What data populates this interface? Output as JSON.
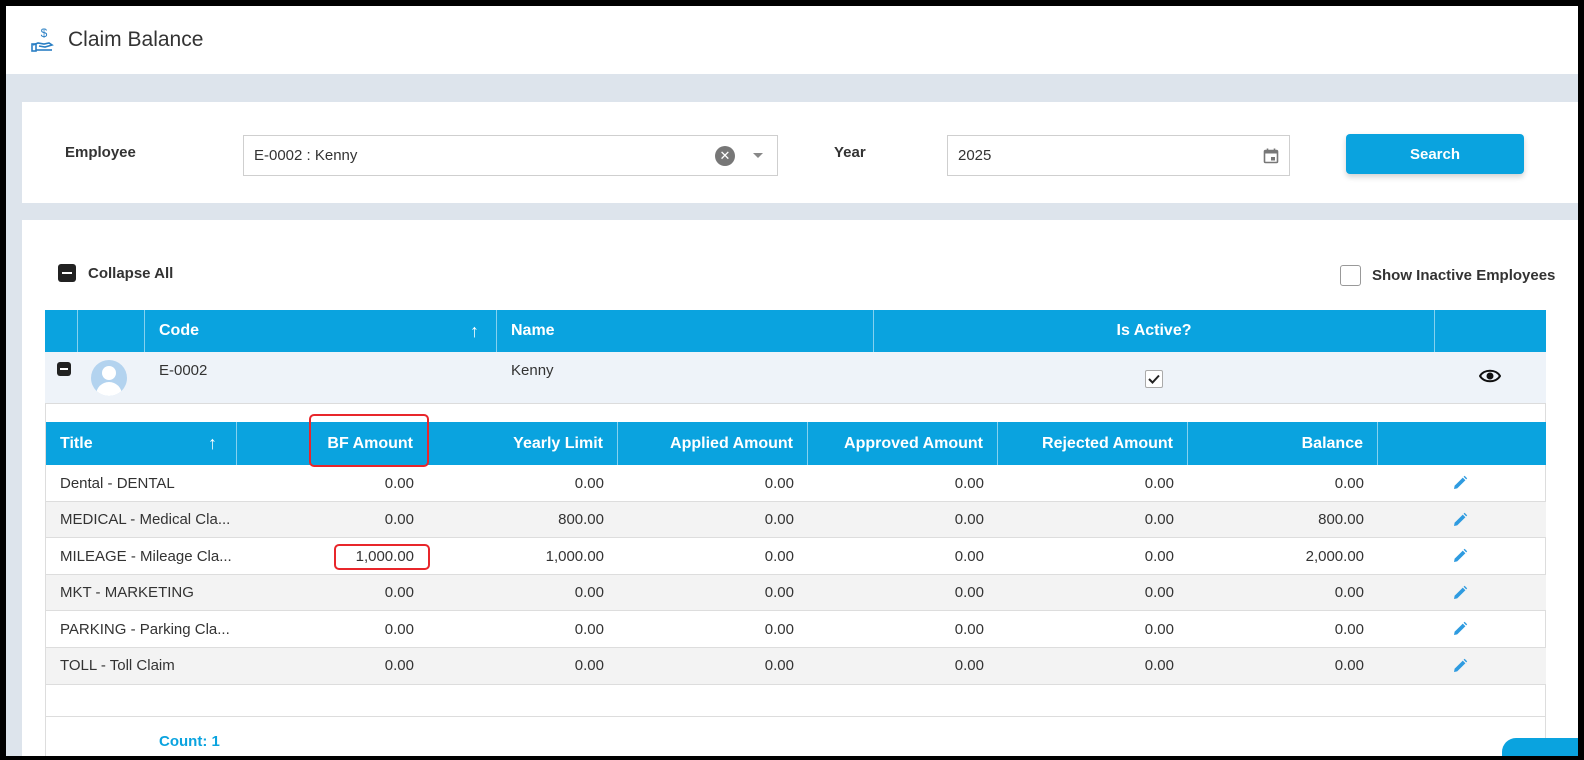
{
  "header": {
    "title": "Claim Balance",
    "icon": "hand-coin-icon"
  },
  "filters": {
    "employee_label": "Employee",
    "employee_value": "E-0002 : Kenny",
    "year_label": "Year",
    "year_value": "2025",
    "search_label": "Search"
  },
  "toolbar": {
    "collapse_all": "Collapse All",
    "show_inactive": "Show Inactive Employees"
  },
  "outer_columns": {
    "code": "Code",
    "name": "Name",
    "is_active": "Is Active?"
  },
  "employee": {
    "code": "E-0002",
    "name": "Kenny",
    "is_active": true
  },
  "claim_columns": {
    "title": "Title",
    "bf_amount": "BF Amount",
    "yearly_limit": "Yearly Limit",
    "applied_amount": "Applied Amount",
    "approved_amount": "Approved Amount",
    "rejected_amount": "Rejected Amount",
    "balance": "Balance"
  },
  "claims": [
    {
      "title": "Dental - DENTAL",
      "bf": "0.00",
      "limit": "0.00",
      "applied": "0.00",
      "approved": "0.00",
      "rejected": "0.00",
      "balance": "0.00"
    },
    {
      "title": "MEDICAL - Medical Cla...",
      "bf": "0.00",
      "limit": "800.00",
      "applied": "0.00",
      "approved": "0.00",
      "rejected": "0.00",
      "balance": "800.00"
    },
    {
      "title": "MILEAGE - Mileage Cla...",
      "bf": "1,000.00",
      "limit": "1,000.00",
      "applied": "0.00",
      "approved": "0.00",
      "rejected": "0.00",
      "balance": "2,000.00"
    },
    {
      "title": "MKT - MARKETING",
      "bf": "0.00",
      "limit": "0.00",
      "applied": "0.00",
      "approved": "0.00",
      "rejected": "0.00",
      "balance": "0.00"
    },
    {
      "title": "PARKING - Parking Cla...",
      "bf": "0.00",
      "limit": "0.00",
      "applied": "0.00",
      "approved": "0.00",
      "rejected": "0.00",
      "balance": "0.00"
    },
    {
      "title": "TOLL - Toll Claim",
      "bf": "0.00",
      "limit": "0.00",
      "applied": "0.00",
      "approved": "0.00",
      "rejected": "0.00",
      "balance": "0.00"
    }
  ],
  "footer": {
    "count": "Count: 1"
  },
  "colors": {
    "accent": "#0aa3df",
    "highlight": "#e8262b"
  }
}
